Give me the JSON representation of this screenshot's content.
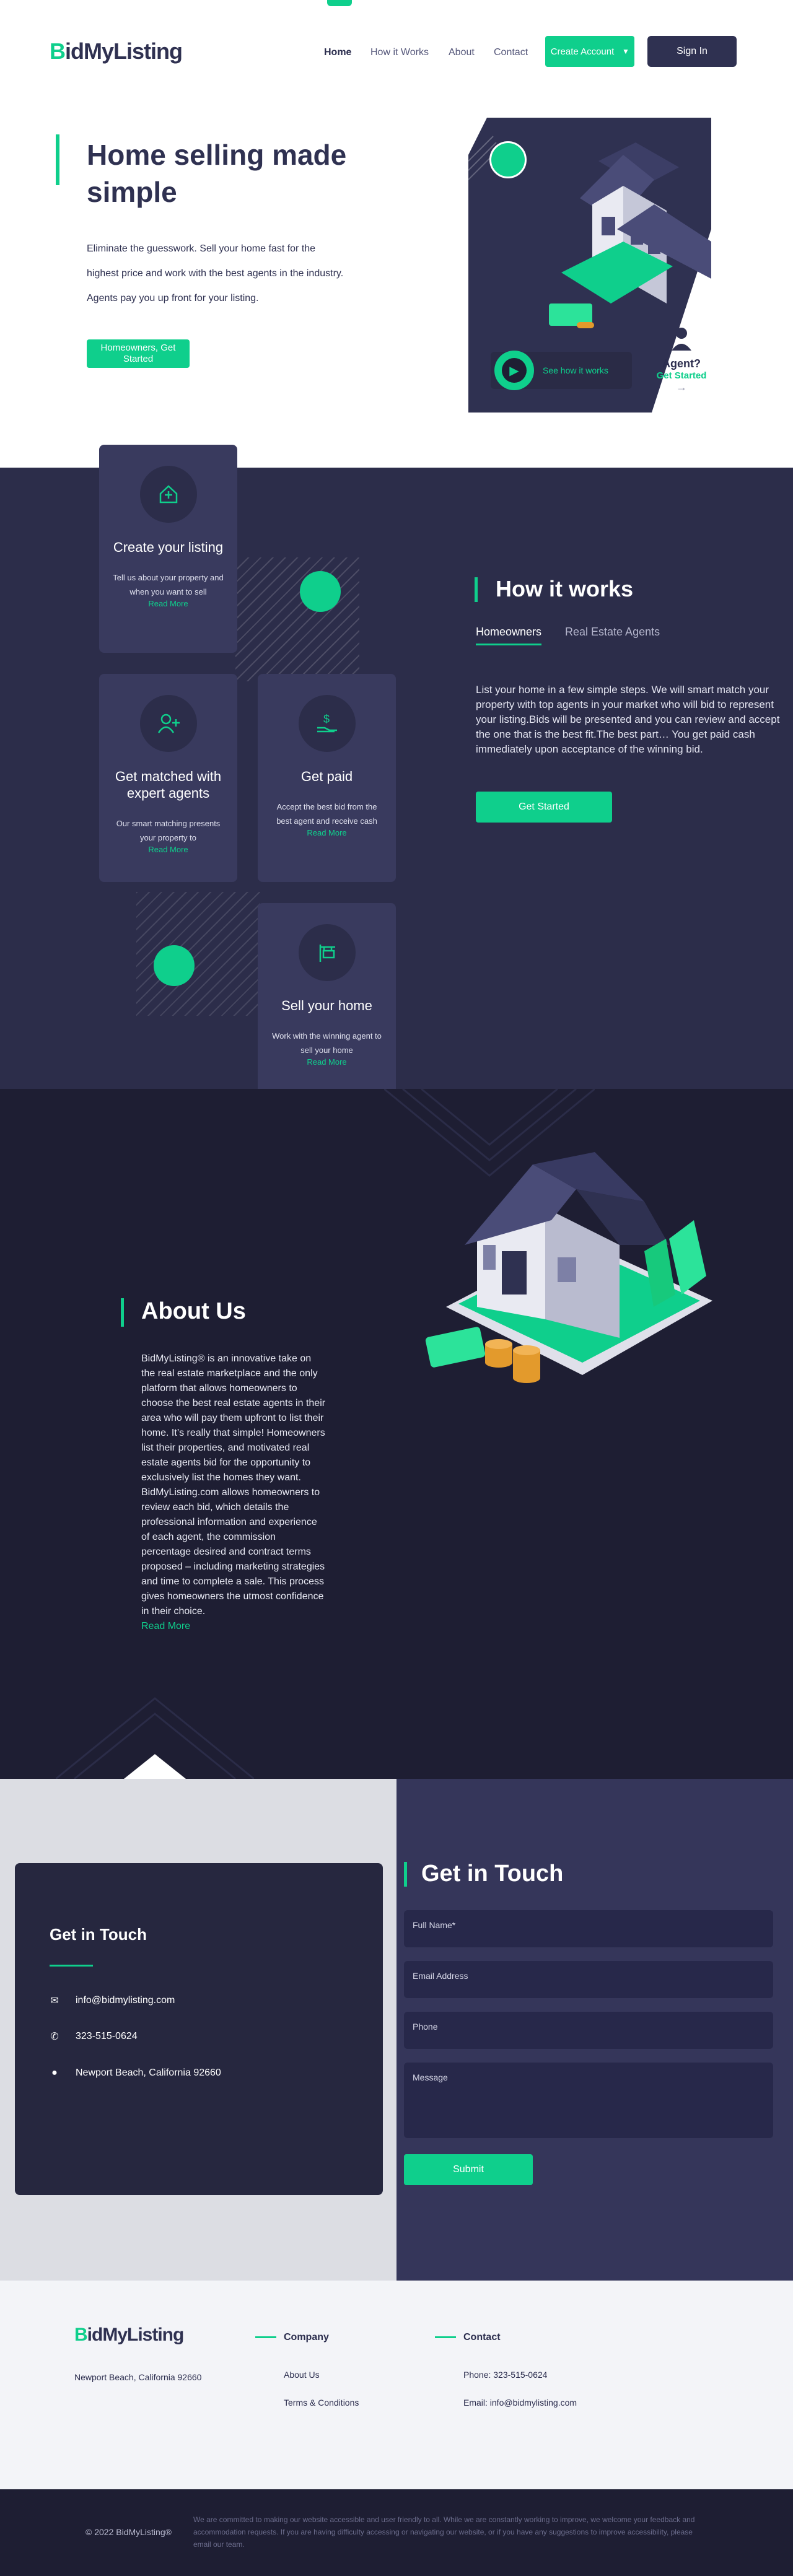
{
  "header": {
    "logo_prefix": "B",
    "logo_text": "idMyListing",
    "nav": [
      "Home",
      "How it Works",
      "About",
      "Contact"
    ],
    "create_account": "Create Account",
    "sign_in": "Sign In"
  },
  "hero": {
    "title": "Home selling made simple",
    "text": "Eliminate the guesswork. Sell your home fast for the highest price and work with the best agents in the industry. Agents pay you up front for your listing.",
    "cta": "Homeowners, Get Started",
    "video_label": "See how it works",
    "agent_q": "Agent?",
    "agent_cta": "Get Started"
  },
  "how": {
    "title": "How it works",
    "tabs": [
      "Homeowners",
      "Real Estate Agents"
    ],
    "text": "List your home in a few simple steps. We will smart match your property with top agents in your market who will bid to represent your listing.Bids will be presented and you can review and accept the one that is the best fit.The best part… You get paid cash immediately upon acceptance of the winning bid.",
    "cta": "Get Started",
    "cards": [
      {
        "title": "Create your listing",
        "text": "Tell us about your property and when you want to sell",
        "link": "Read More"
      },
      {
        "title": "Get matched with expert agents",
        "text": "Our smart matching presents your property to",
        "link": "Read More"
      },
      {
        "title": "Get paid",
        "text": "Accept the best bid from the best agent and receive cash",
        "link": "Read More"
      },
      {
        "title": "Sell your home",
        "text": "Work with the winning agent to sell your home",
        "link": "Read More"
      }
    ]
  },
  "about": {
    "title": "About Us",
    "text": "BidMyListing® is an innovative take on the real estate marketplace and the only platform that allows homeowners to choose the best real estate agents in their area who will pay them upfront to list their home. It’s really that simple! Homeowners list their properties, and motivated real estate agents bid for the opportunity to exclusively list the homes they want. BidMyListing.com allows homeowners to review each bid, which details the professional information and experience of each agent, the commission percentage desired and contract terms proposed – including marketing strategies and time to complete a sale. This process gives homeowners the utmost confidence in their choice.",
    "link": "Read More"
  },
  "contact": {
    "info_title": "Get in Touch",
    "email": "info@bidmylisting.com",
    "phone": "323-515-0624",
    "address": "Newport Beach, California 92660",
    "form_title": "Get in Touch",
    "fields": [
      "Full Name*",
      "Email Address",
      "Phone",
      "Message"
    ],
    "submit": "Submit"
  },
  "footer": {
    "logo_prefix": "B",
    "logo_text": "idMyListing",
    "address": "Newport Beach, California 92660",
    "company_title": "Company",
    "company_links": [
      "About Us",
      "Terms & Conditions"
    ],
    "contact_title": "Contact",
    "phone": "Phone: 323-515-0624",
    "email": "Email: info@bidmylisting.com",
    "copyright": "© 2022 BidMyListing®",
    "disclaimer": "We are committed to making our website accessible and user friendly to all. While we are constantly working to improve, we welcome your feedback and accommodation requests. If you are having difficulty accessing or navigating our website, or if you have any suggestions to improve accessibility, please email our team."
  },
  "colors": {
    "accent": "#0fcf8c",
    "navy": "#2c2d4a",
    "dark": "#1e1e33"
  }
}
